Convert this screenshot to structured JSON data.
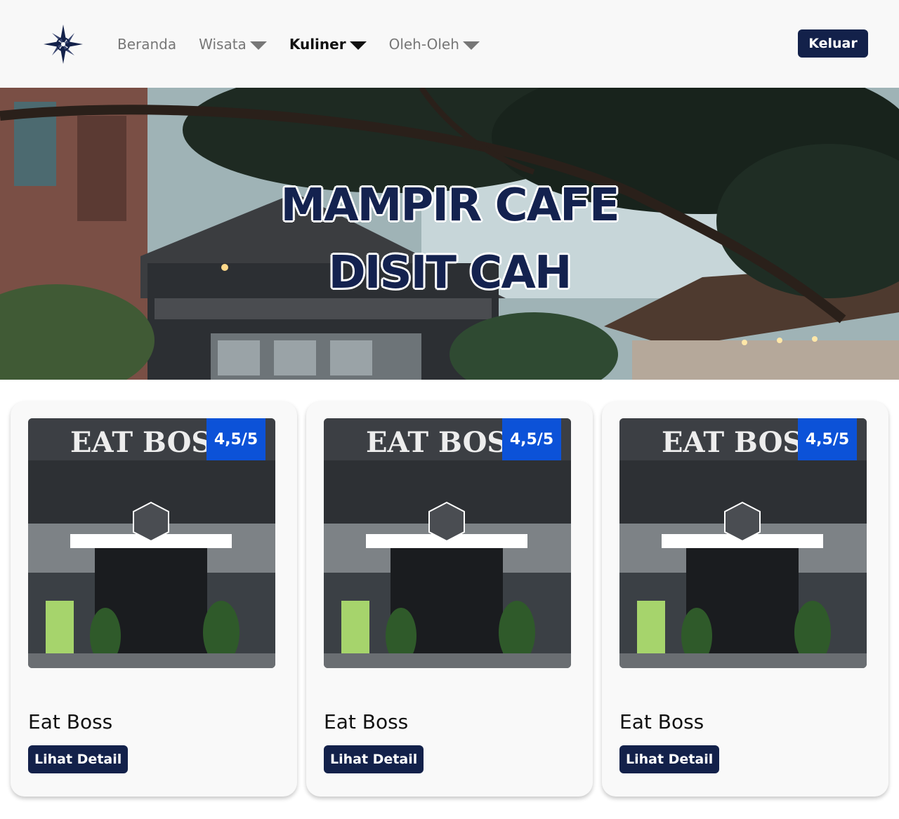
{
  "nav": {
    "logo_icon": "compass-star-icon",
    "items": [
      {
        "label": "Beranda",
        "dropdown": false,
        "active": false
      },
      {
        "label": "Wisata",
        "dropdown": true,
        "active": false
      },
      {
        "label": "Kuliner",
        "dropdown": true,
        "active": true
      },
      {
        "label": "Oleh-Oleh",
        "dropdown": true,
        "active": false
      }
    ],
    "logout_label": "Keluar"
  },
  "hero": {
    "title_line1": "MAMPIR CAFE",
    "title_line2": "DISIT CAH"
  },
  "cards": [
    {
      "rating": "4,5/5",
      "name": "Eat Boss",
      "button": "Lihat Detail"
    },
    {
      "rating": "4,5/5",
      "name": "Eat Boss",
      "button": "Lihat Detail"
    },
    {
      "rating": "4,5/5",
      "name": "Eat Boss",
      "button": "Lihat Detail"
    }
  ],
  "colors": {
    "navy": "#13214a",
    "badge_blue": "#0c52d8",
    "nav_background": "#f8f8f8"
  }
}
